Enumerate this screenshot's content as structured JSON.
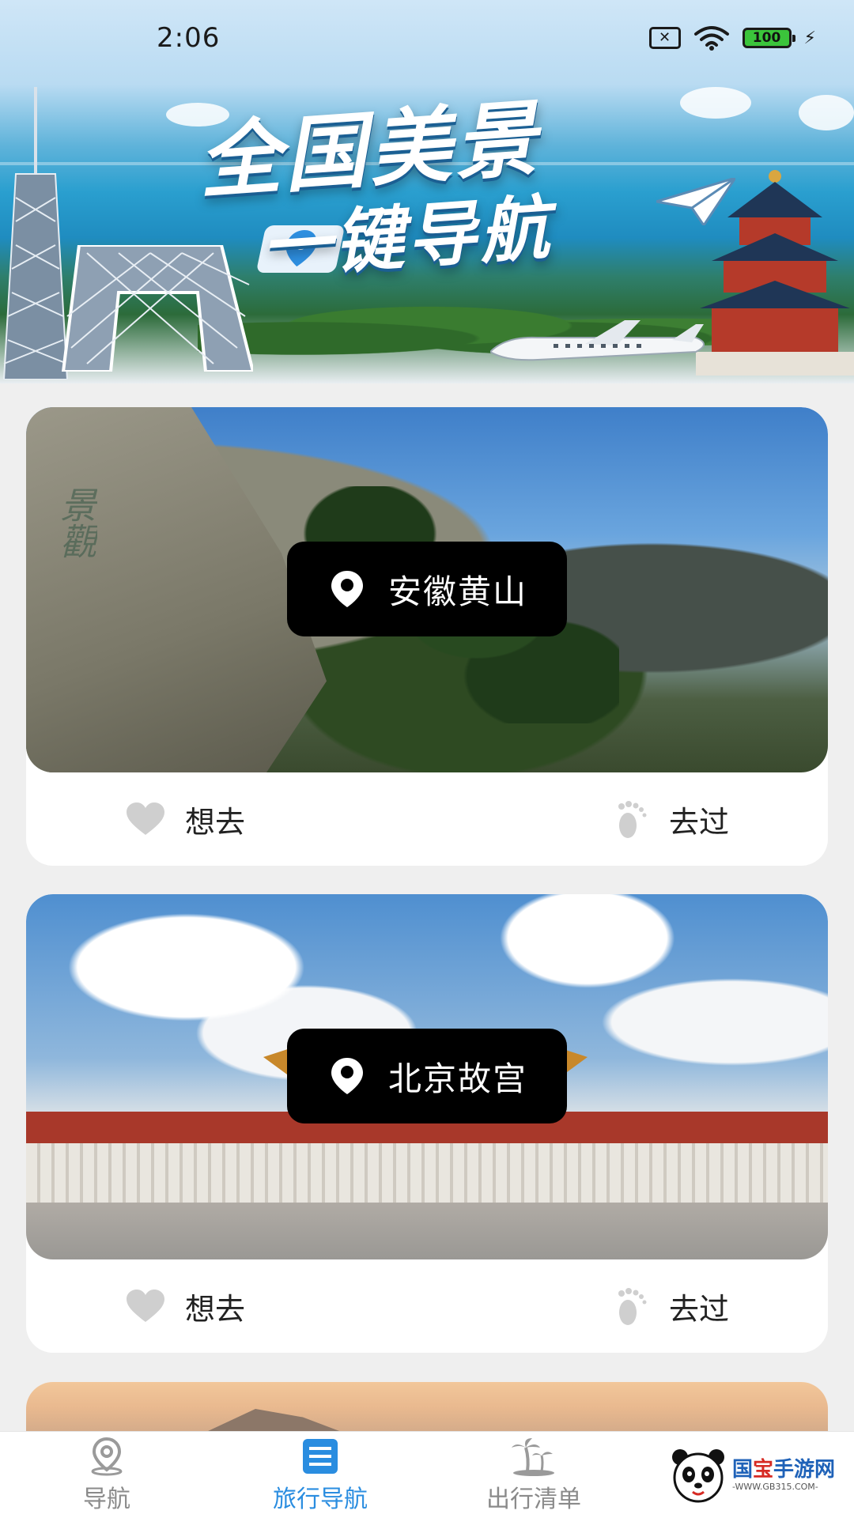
{
  "status_bar": {
    "time": "2:06",
    "battery": "100"
  },
  "banner": {
    "title_line1": "全国美景",
    "title_line2": "一键导航"
  },
  "cards": [
    {
      "location": "安徽黄山",
      "want_label": "想去",
      "visited_label": "去过"
    },
    {
      "location": "北京故宫",
      "want_label": "想去",
      "visited_label": "去过"
    }
  ],
  "bottom_nav": {
    "items": [
      {
        "label": "导航",
        "icon": "map-pin-icon",
        "active": false
      },
      {
        "label": "旅行导航",
        "icon": "list-icon",
        "active": true
      },
      {
        "label": "出行清单",
        "icon": "palm-tree-icon",
        "active": false
      }
    ],
    "active_color": "#2a8de0",
    "inactive_color": "#8a8a8a"
  },
  "watermark": {
    "title_part1": "国",
    "title_part2": "宝",
    "title_part3": "手游网",
    "url": "-WWW.GB315.COM-"
  }
}
